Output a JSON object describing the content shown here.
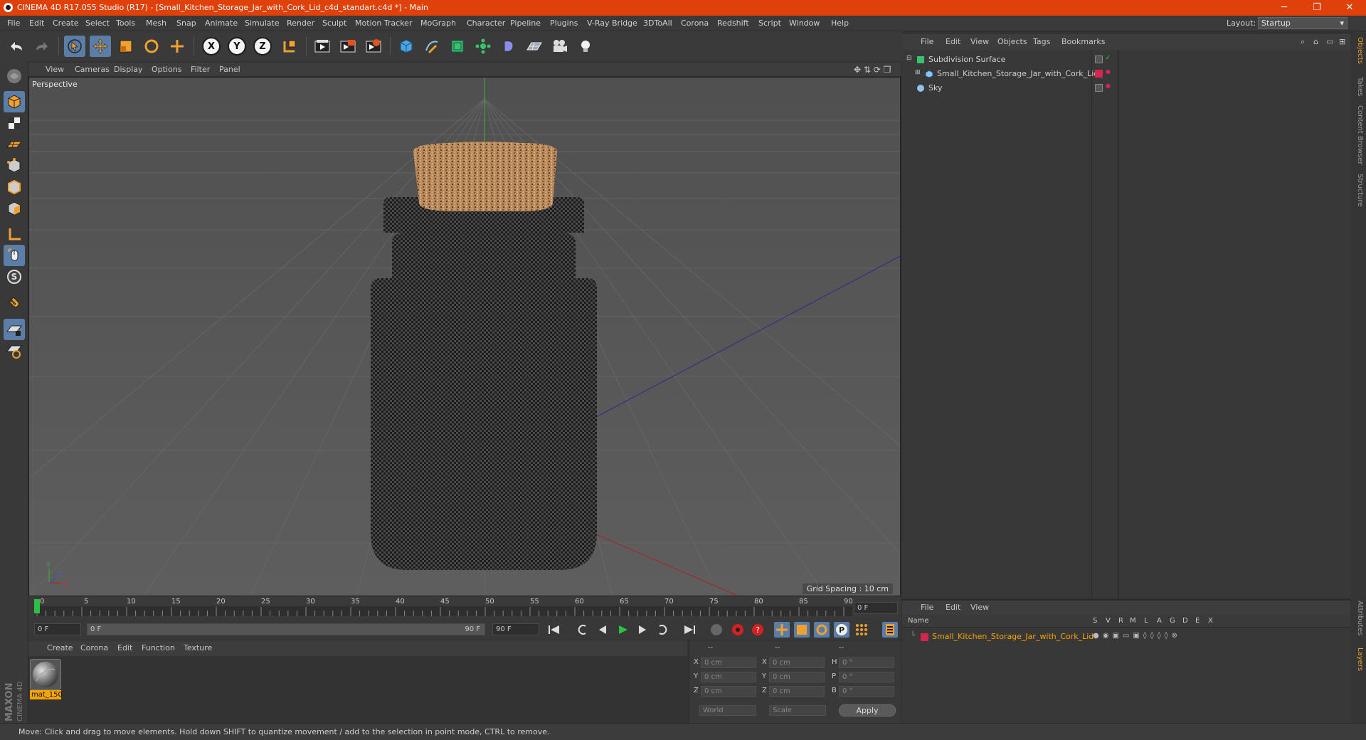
{
  "window": {
    "title": "CINEMA 4D R17.055 Studio (R17) - [Small_Kitchen_Storage_Jar_with_Cork_Lid_c4d_standart.c4d *] - Main",
    "controls": [
      "─",
      "❐",
      "✕"
    ]
  },
  "menubar": {
    "items": [
      "File",
      "Edit",
      "Create",
      "Select",
      "Tools",
      "Mesh",
      "Snap",
      "Animate",
      "Simulate",
      "Render",
      "Sculpt",
      "Motion Tracker",
      "MoGraph",
      "Character",
      "Pipeline",
      "Plugins",
      "V-Ray Bridge",
      "3DToAll",
      "Corona",
      "Redshift",
      "Script",
      "Window",
      "Help"
    ],
    "layout_label": "Layout:",
    "layout_value": "Startup"
  },
  "toolbar": {
    "icons": [
      "undo-icon",
      "redo-icon",
      "select-arrow-icon",
      "move-icon",
      "scale-icon",
      "rotate-icon",
      "live-transform-icon",
      "x-axis-icon",
      "y-axis-icon",
      "z-axis-icon",
      "world-coords-icon",
      "render-view-icon",
      "render-picture-viewer-icon",
      "edit-render-settings-icon",
      "cube-icon",
      "pen-spline-icon",
      "subdivision-icon",
      "array-icon",
      "deformer-icon",
      "floor-icon",
      "camera-icon",
      "light-icon"
    ],
    "axis_labels": [
      "X",
      "Y",
      "Z"
    ]
  },
  "viewport": {
    "menu": [
      "View",
      "Cameras",
      "Display",
      "Options",
      "Filter",
      "Panel"
    ],
    "label": "Perspective",
    "grid_spacing": "Grid Spacing : 10 cm",
    "axis_letters": [
      "Y",
      "X",
      "Z"
    ]
  },
  "timeline": {
    "ticks": [
      "0",
      "5",
      "10",
      "15",
      "20",
      "25",
      "30",
      "35",
      "40",
      "45",
      "50",
      "55",
      "60",
      "65",
      "70",
      "75",
      "80",
      "85",
      "90"
    ],
    "current_frame": "0 F"
  },
  "frame_row": {
    "start": "0 F",
    "range_start": "0 F",
    "range_end": "90 F",
    "end": "90 F"
  },
  "material_manager": {
    "menu": [
      "Create",
      "Corona",
      "Edit",
      "Function",
      "Texture"
    ],
    "materials": [
      "mat_150"
    ]
  },
  "coordinates": {
    "headers": [
      "--",
      "--",
      "--"
    ],
    "rows": [
      {
        "pos_label": "X",
        "pos": "0 cm",
        "size_label": "X",
        "size": "0 cm",
        "rot_label": "H",
        "rot": "0 °"
      },
      {
        "pos_label": "Y",
        "pos": "0 cm",
        "size_label": "Y",
        "size": "0 cm",
        "rot_label": "P",
        "rot": "0 °"
      },
      {
        "pos_label": "Z",
        "pos": "0 cm",
        "size_label": "Z",
        "size": "0 cm",
        "rot_label": "B",
        "rot": "0 °"
      }
    ],
    "mode1": "World",
    "mode2": "Scale",
    "apply": "Apply"
  },
  "status": "Move: Click and drag to move elements. Hold down SHIFT to quantize movement / add to the selection in point mode, CTRL to remove.",
  "object_manager": {
    "menu": [
      "File",
      "Edit",
      "View",
      "Objects",
      "Tags",
      "Bookmarks"
    ],
    "objects": [
      {
        "name": "Subdivision Surface",
        "icon": "subdivision-icon"
      },
      {
        "name": "Small_Kitchen_Storage_Jar_with_Cork_Lid",
        "icon": "polygon-object-icon"
      },
      {
        "name": "Sky",
        "icon": "sky-icon"
      }
    ]
  },
  "layer_manager": {
    "menu": [
      "File",
      "Edit",
      "View"
    ],
    "headers": [
      "Name",
      "S",
      "V",
      "R",
      "M",
      "L",
      "A",
      "G",
      "D",
      "E",
      "X"
    ],
    "layers": [
      {
        "name": "Small_Kitchen_Storage_Jar_with_Cork_Lid",
        "color": "#d4264f"
      }
    ]
  },
  "side_tabs": [
    "Objects",
    "Takes",
    "Content Browser",
    "Structure",
    "Attributes",
    "Layers"
  ],
  "brand": "MAXON CINEMA 4D",
  "colors": {
    "title_bar": "#e0400a",
    "active_tool": "#5a7ea8",
    "layer_color": "#d4264f",
    "material_highlight": "#f7a400"
  }
}
